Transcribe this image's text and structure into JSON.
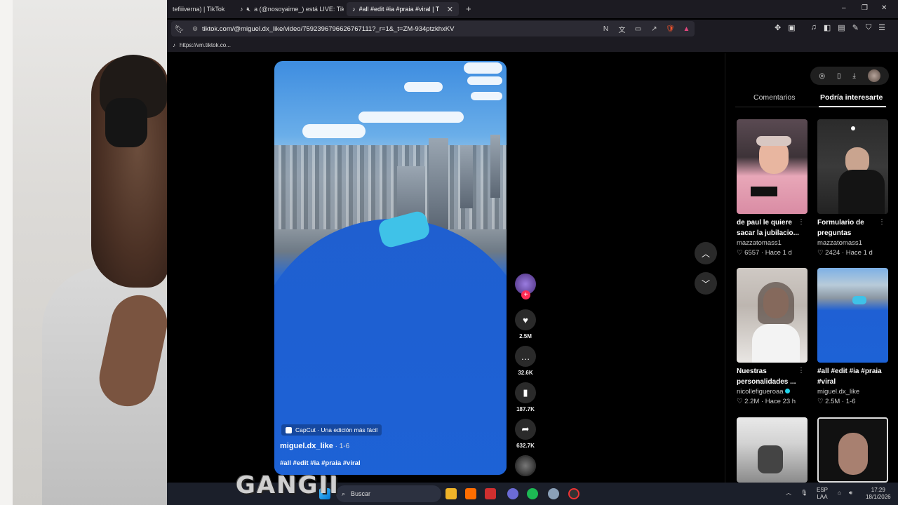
{
  "browser": {
    "tabs": [
      {
        "title": "tefiiiverna) | TikTok",
        "active": false
      },
      {
        "title": "a (@nosoyaime_) está LIVE: TikTok",
        "active": false
      },
      {
        "title": "#all #edit #ia #praia #viral | TikTok",
        "active": true
      }
    ],
    "new_tab": "+",
    "url": "tiktok.com/@miguel.dx_like/video/7592396796626767111?_r=1&_t=ZM-934ptzkhxKV",
    "bookmark": "https://vm.tiktok.co...",
    "window": {
      "minimize": "–",
      "restore": "❐",
      "close": "✕"
    }
  },
  "video": {
    "capcut_label": "CapCut · Una edición más fácil",
    "author": "miguel.dx_like",
    "date": " · 1-6",
    "hashtags": "#all #edit #ia #praia #viral"
  },
  "actions": {
    "likes": "2.5M",
    "comments": "32.6K",
    "saves": "187.7K",
    "shares": "632.7K"
  },
  "panel": {
    "tab_comments": "Comentarios",
    "tab_suggested": "Podría interesarte",
    "cards": [
      {
        "title": "de paul le quiere sacar la jubilacio...",
        "user": "mazzatomass1",
        "likes": "6557",
        "time": "Hace 1 d",
        "verified": false
      },
      {
        "title": "Formulario de preguntas",
        "user": "mazzatomass1",
        "likes": "2424",
        "time": "Hace 1 d",
        "verified": false
      },
      {
        "title": "Nuestras personalidades ...",
        "user": "nicollefigueroaa",
        "likes": "2.2M",
        "time": "Hace 23 h",
        "verified": true
      },
      {
        "title": "#all #edit #ia #praia #viral",
        "user": "miguel.dx_like",
        "likes": "2.5M",
        "time": "1-6",
        "verified": false
      }
    ]
  },
  "taskbar": {
    "search_placeholder": "Buscar",
    "watermark": "GANGII",
    "lang1": "ESP",
    "lang2": "LAA",
    "time": "17:29",
    "date": "18/1/2026"
  },
  "colors": {
    "accent": "#fe2c55",
    "background": "#000000",
    "chrome": "#1c1b22",
    "urlbar": "#2b2a33"
  },
  "icons": [
    "bookmark-icon",
    "heart-icon",
    "comment-icon",
    "save-icon",
    "share-icon",
    "chevron-up-icon",
    "chevron-down-icon",
    "search-icon",
    "windows-start-icon"
  ]
}
